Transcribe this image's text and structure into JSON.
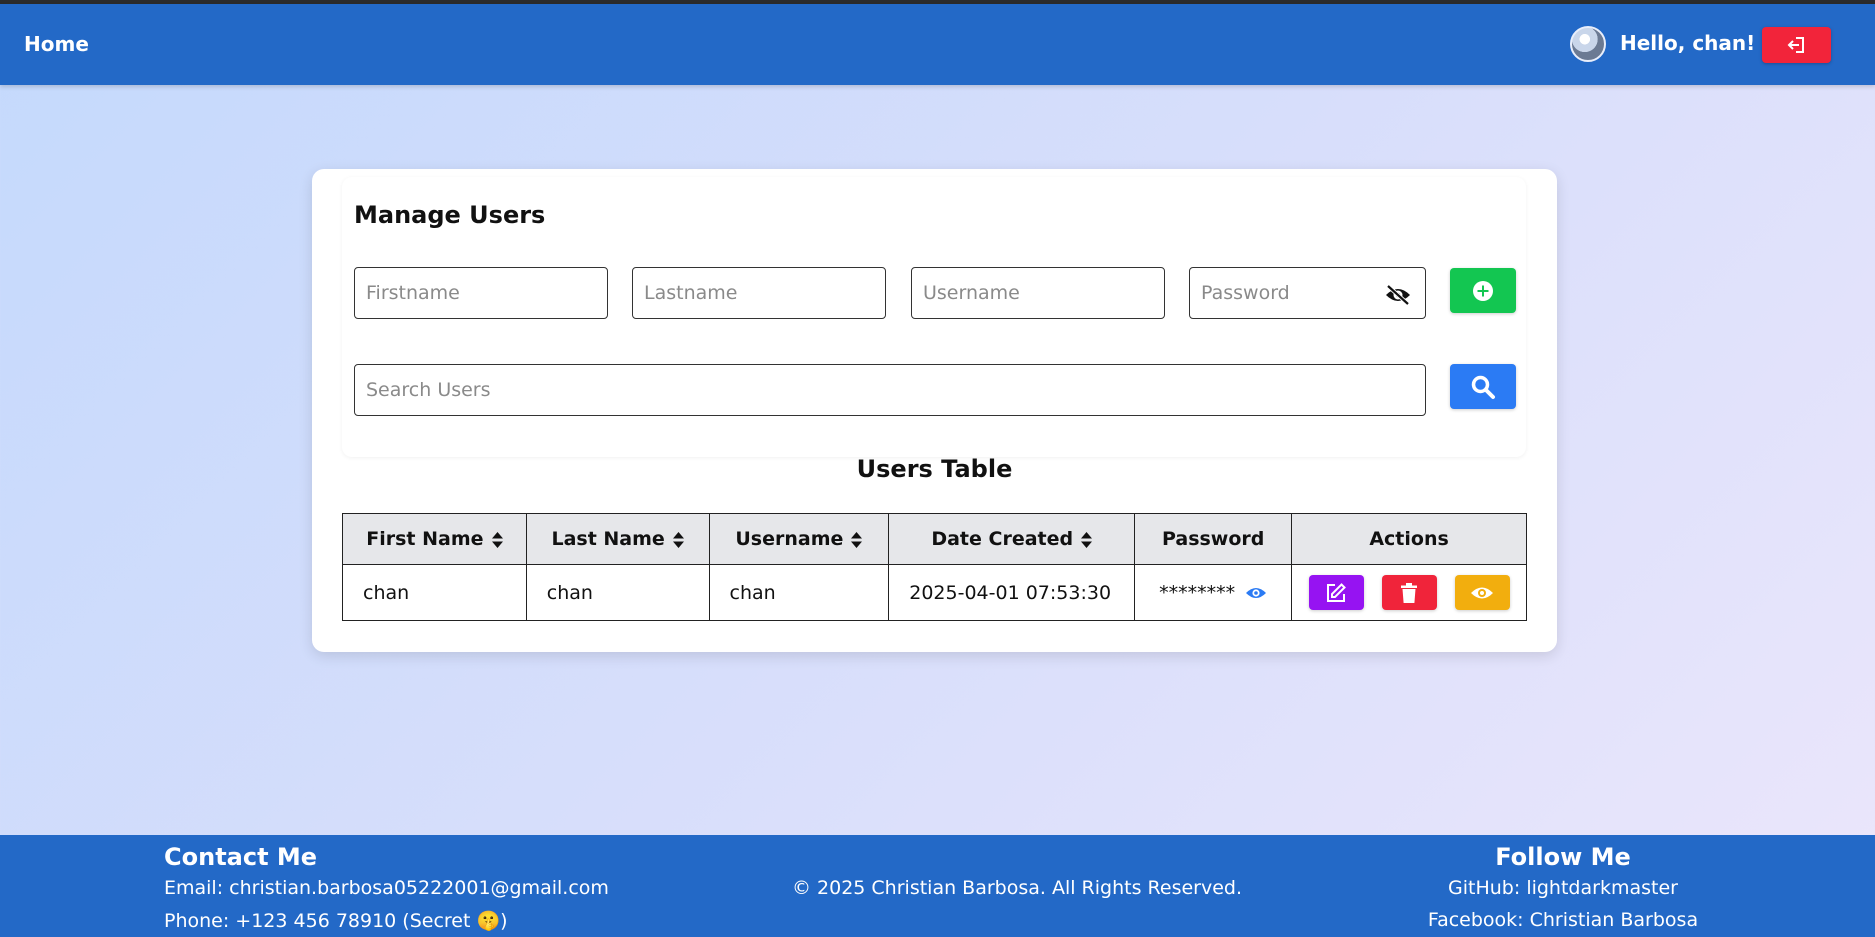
{
  "nav": {
    "home_label": "Home",
    "greeting": "Hello,  chan!"
  },
  "manage": {
    "title": "Manage Users",
    "firstname_placeholder": "Firstname",
    "lastname_placeholder": "Lastname",
    "username_placeholder": "Username",
    "password_placeholder": "Password",
    "search_placeholder": "Search Users"
  },
  "table": {
    "title": "Users Table",
    "headers": [
      "First Name",
      "Last Name",
      "Username",
      "Date Created",
      "Password",
      "Actions"
    ],
    "rows": [
      {
        "first_name": "chan",
        "last_name": "chan",
        "username": "chan",
        "date_created": "2025-04-01 07:53:30",
        "password_masked": "********"
      }
    ]
  },
  "footer": {
    "contact_title": "Contact Me",
    "email_line": "Email: christian.barbosa05222001@gmail.com",
    "phone_line": "Phone: +123 456 78910 (Secret 🤫)",
    "copyright": "© 2025 Christian Barbosa. All Rights Reserved.",
    "follow_title": "Follow Me",
    "github_line": "GitHub: lightdarkmaster",
    "facebook_line": "Facebook: Christian Barbosa"
  },
  "colors": {
    "navbar": "#2369c7",
    "logout": "#f2243a",
    "add": "#13c651",
    "search": "#2b7bf4",
    "edit": "#9613f2",
    "delete": "#f0243a",
    "view": "#f2ae0e"
  },
  "icons": {
    "logout": "logout-icon",
    "add": "plus-circle-icon",
    "search": "search-icon",
    "password_toggle": "eye-slash-icon",
    "sort": "sort-icon",
    "reveal": "eye-icon",
    "edit": "edit-icon",
    "delete": "trash-icon",
    "view": "eye-icon"
  }
}
